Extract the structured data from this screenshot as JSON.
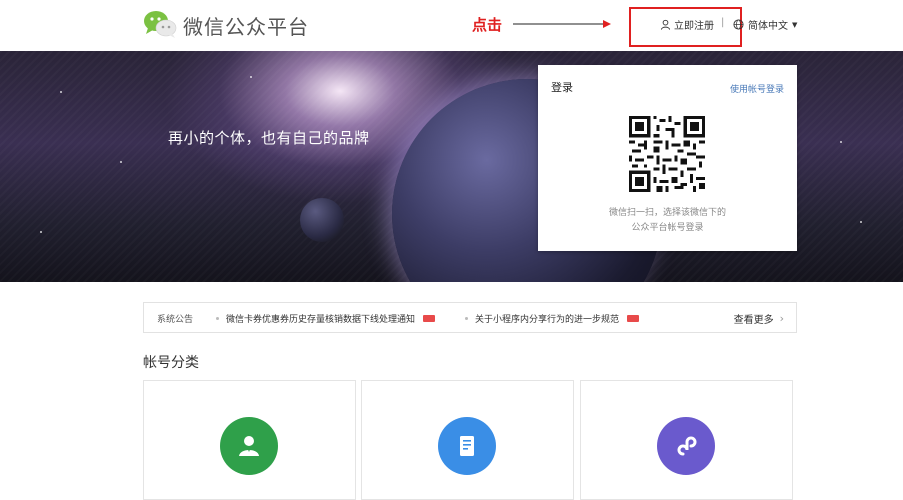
{
  "header": {
    "brand": "微信公众平台",
    "annotation_text": "点击",
    "register_label": "立即注册",
    "separator": "|",
    "language_label": "简体中文",
    "accent_red": "#e02020"
  },
  "banner": {
    "slogan": "再小的个体，也有自己的品牌"
  },
  "login": {
    "title": "登录",
    "switch_label": "使用帐号登录",
    "hint_line1": "微信扫一扫，选择该微信下的",
    "hint_line2": "公众平台帐号登录"
  },
  "notice": {
    "label": "系统公告",
    "items": [
      {
        "text": "微信卡券优惠券历史存量核销数据下线处理通知"
      },
      {
        "text": "关于小程序内分享行为的进一步规范"
      }
    ],
    "more_label": "查看更多"
  },
  "accounts": {
    "title": "帐号分类",
    "cards": [
      {
        "icon": "service-account-icon",
        "color": "#2fa04a"
      },
      {
        "icon": "subscription-account-icon",
        "color": "#3a8ee6"
      },
      {
        "icon": "mini-program-icon",
        "color": "#6a5acd"
      }
    ]
  }
}
